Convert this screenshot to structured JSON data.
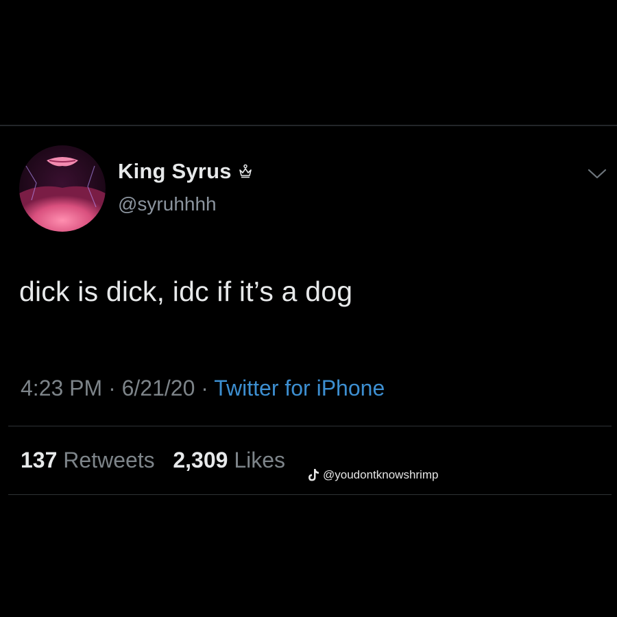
{
  "tweet": {
    "display_name": "King Syrus",
    "handle": "@syruhhhh",
    "text": "dick is dick, idc if it’s a dog",
    "time": "4:23 PM",
    "date": "6/21/20",
    "separator": "·",
    "source": "Twitter for iPhone",
    "retweets_count": "137",
    "retweets_label": "Retweets",
    "likes_count": "2,309",
    "likes_label": "Likes"
  },
  "icons": {
    "crown": "crown-icon",
    "menu": "chevron-down-icon",
    "watermark": "tiktok-icon"
  },
  "watermark": {
    "text": "@youdontknowshrimp"
  },
  "colors": {
    "background": "#000000",
    "text_primary": "#e7e9ea",
    "text_secondary": "#7d8489",
    "link": "#3d8fd1",
    "avatar_accent": "#e05c8a"
  }
}
